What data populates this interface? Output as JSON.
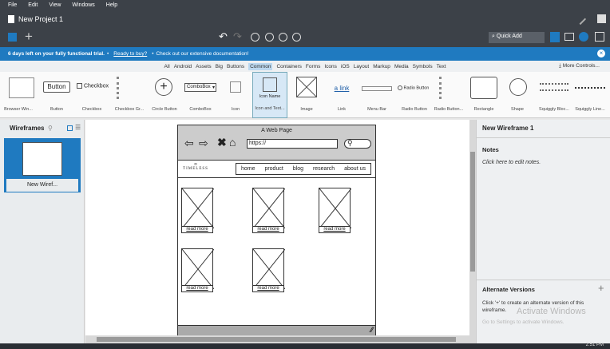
{
  "menu": [
    "File",
    "Edit",
    "View",
    "Windows",
    "Help"
  ],
  "project_title": "New Project 1",
  "quick_add": "Quick Add",
  "trial": {
    "days": "6 days left on your fully functional trial.",
    "sep1": "•",
    "buy": "Ready to buy?",
    "sep2": "•",
    "docs": "Check out our extensive documentation!"
  },
  "filters": [
    "All",
    "Android",
    "Assets",
    "Big",
    "Buttons",
    "Common",
    "Containers",
    "Forms",
    "Icons",
    "iOS",
    "Layout",
    "Markup",
    "Media",
    "Symbols",
    "Text"
  ],
  "filter_selected": "Common",
  "more_controls": "More Controls...",
  "library": [
    "Browser Win...",
    "Button",
    "Checkbox",
    "Checkbox Gr...",
    "Circle Button",
    "ComboBox",
    "Icon",
    "Icon and Text...",
    "Image",
    "Link",
    "Menu Bar",
    "Radio Button",
    "Radio Button...",
    "Rectangle",
    "Shape",
    "Squiggly Bloc...",
    "Squiggly Line..."
  ],
  "lib_button_text": "Button",
  "lib_checkbox_text": "Checkbox",
  "lib_combobox_text": "ComboBox",
  "lib_icon_name": "Icon Name",
  "lib_link_text": "a link",
  "lib_radio_text": "Radio Button",
  "left": {
    "title": "Wireframes",
    "thumb_label": "New Wiref..."
  },
  "wireframe": {
    "title": "A Web Page",
    "url": "https://",
    "logo": "TIMELESS",
    "nav": [
      "home",
      "product",
      "blog",
      "research",
      "about us"
    ],
    "read_more": "read more"
  },
  "right": {
    "title": "New Wireframe 1",
    "notes_label": "Notes",
    "notes_hint": "Click here to edit notes.",
    "alt_label": "Alternate Versions",
    "alt_hint": "Click '+' to create an alternate version of this wireframe.",
    "watermark1": "Activate Windows",
    "watermark2": "Go to Settings to activate Windows."
  },
  "clock": "2:51 PM"
}
